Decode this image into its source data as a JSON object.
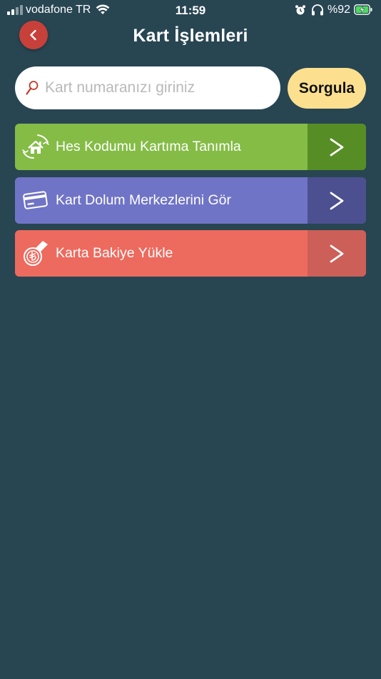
{
  "status_bar": {
    "carrier": "vodafone TR",
    "time": "11:59",
    "battery_percent": "%92",
    "icons": [
      "signal-icon",
      "wifi-icon",
      "alarm-icon",
      "headphones-icon",
      "battery-charging-icon"
    ]
  },
  "header": {
    "title": "Kart İşlemleri",
    "back_icon": "chevron-left-icon"
  },
  "search": {
    "placeholder": "Kart numaranızı giriniz",
    "value": "",
    "icon": "search-icon",
    "button_label": "Sorgula"
  },
  "menu": {
    "items": [
      {
        "label": "Hes Kodumu Kartıma Tanımla",
        "icon": "home-hands-icon",
        "arrow_icon": "chevron-right-icon",
        "color": "#84bc46",
        "arrow_color": "#568e25"
      },
      {
        "label": "Kart Dolum Merkezlerini Gör",
        "icon": "credit-card-icon",
        "arrow_icon": "chevron-right-icon",
        "color": "#7074c6",
        "arrow_color": "#4c5091"
      },
      {
        "label": "Karta Bakiye Yükle",
        "icon": "lira-coin-card-icon",
        "arrow_icon": "chevron-right-icon",
        "color": "#ed6a5e",
        "arrow_color": "#cc5f57"
      }
    ]
  },
  "colors": {
    "background": "#284552",
    "back_button": "#c8403a",
    "query_button": "#fde08f",
    "search_field": "#ffffff"
  }
}
